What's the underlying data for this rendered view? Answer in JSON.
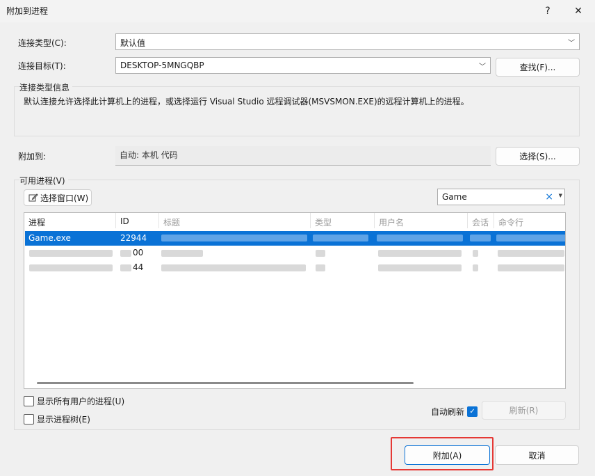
{
  "window": {
    "title": "附加到进程",
    "help_label": "?",
    "close_label": "✕"
  },
  "connection": {
    "type_label": "连接类型(C):",
    "type_value": "默认值",
    "target_label": "连接目标(T):",
    "target_value": "DESKTOP-5MNGQBP",
    "find_button": "查找(F)..."
  },
  "info": {
    "title": "连接类型信息",
    "text": "默认连接允许选择此计算机上的进程，或选择运行 Visual Studio 远程调试器(MSVSMON.EXE)的远程计算机上的进程。"
  },
  "attach_to": {
    "label": "附加到:",
    "value": "自动: 本机 代码",
    "select_button": "选择(S)..."
  },
  "processes": {
    "group_title": "可用进程(V)",
    "select_window_button": "选择窗口(W)",
    "filter_value": "Game",
    "filter_clear": "×",
    "columns": [
      "进程",
      "ID",
      "标题",
      "类型",
      "用户名",
      "会话",
      "命令行"
    ],
    "rows": [
      {
        "process": "Game.exe",
        "id": "22944",
        "selected": true
      },
      {
        "process": "",
        "id": "00",
        "selected": false
      },
      {
        "process": "",
        "id": "44",
        "selected": false
      }
    ]
  },
  "options": {
    "show_all_users": "显示所有用户的进程(U)",
    "show_tree": "显示进程树(E)",
    "auto_refresh": "自动刷新",
    "refresh_button": "刷新(R)"
  },
  "footer": {
    "attach_button": "附加(A)",
    "cancel_button": "取消"
  }
}
